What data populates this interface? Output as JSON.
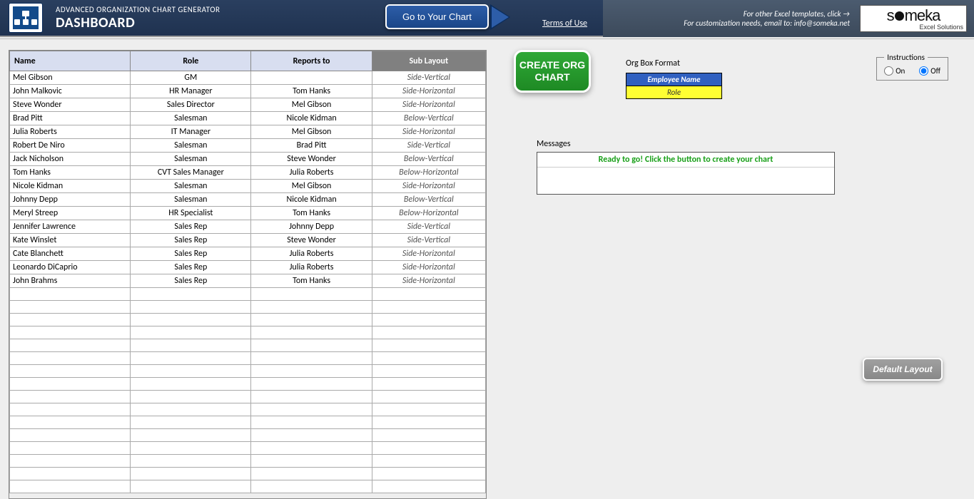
{
  "header": {
    "title_small": "ADVANCED ORGANIZATION CHART GENERATOR",
    "title_large": "DASHBOARD",
    "go_chart": "Go to Your Chart",
    "terms": "Terms of Use",
    "right_line1": "For other Excel templates, click →",
    "right_line2": "For customization needs, email to: info@someka.net",
    "logo_main": "someka",
    "logo_sub": "Excel Solutions"
  },
  "table": {
    "headers": {
      "name": "Name",
      "role": "Role",
      "reports": "Reports to",
      "sub": "Sub Layout"
    },
    "rows": [
      {
        "name": "Mel Gibson",
        "role": "GM",
        "reports": "",
        "sub": "Side-Vertical"
      },
      {
        "name": "John Malkovic",
        "role": "HR Manager",
        "reports": "Tom Hanks",
        "sub": "Side-Horizontal"
      },
      {
        "name": "Steve Wonder",
        "role": "Sales Director",
        "reports": "Mel Gibson",
        "sub": "Side-Horizontal"
      },
      {
        "name": "Brad Pitt",
        "role": "Salesman",
        "reports": "Nicole Kidman",
        "sub": "Below-Vertical"
      },
      {
        "name": "Julia Roberts",
        "role": "IT Manager",
        "reports": "Mel Gibson",
        "sub": "Side-Horizontal"
      },
      {
        "name": "Robert De Niro",
        "role": "Salesman",
        "reports": "Brad Pitt",
        "sub": "Side-Vertical"
      },
      {
        "name": "Jack Nicholson",
        "role": "Salesman",
        "reports": "Steve Wonder",
        "sub": "Below-Vertical"
      },
      {
        "name": "Tom Hanks",
        "role": "CVT Sales Manager",
        "reports": "Julia Roberts",
        "sub": "Below-Horizontal"
      },
      {
        "name": "Nicole Kidman",
        "role": "Salesman",
        "reports": "Mel Gibson",
        "sub": "Side-Horizontal"
      },
      {
        "name": "Johnny Depp",
        "role": "Salesman",
        "reports": "Nicole Kidman",
        "sub": "Below-Vertical"
      },
      {
        "name": "Meryl Streep",
        "role": "HR Specialist",
        "reports": "Tom Hanks",
        "sub": "Below-Horizontal"
      },
      {
        "name": "Jennifer Lawrence",
        "role": "Sales Rep",
        "reports": "Johnny Depp",
        "sub": "Side-Vertical"
      },
      {
        "name": "Kate Winslet",
        "role": "Sales Rep",
        "reports": "Steve Wonder",
        "sub": "Side-Vertical"
      },
      {
        "name": "Cate Blanchett",
        "role": "Sales Rep",
        "reports": "Julia Roberts",
        "sub": "Side-Horizontal"
      },
      {
        "name": "Leonardo DiCaprio",
        "role": "Sales Rep",
        "reports": "Julia Roberts",
        "sub": "Side-Horizontal"
      },
      {
        "name": "John Brahms",
        "role": "Sales Rep",
        "reports": "Tom Hanks",
        "sub": "Side-Horizontal"
      }
    ],
    "empty_rows": 16
  },
  "controls": {
    "create_line1": "CREATE ORG",
    "create_line2": "CHART",
    "format_title": "Org Box Format",
    "format_row1": "Employee Name",
    "format_row2": "Role",
    "messages_title": "Messages",
    "messages_ready": "Ready to go! Click the button to create your chart",
    "default_layout": "Default Layout",
    "instructions_title": "Instructions",
    "instructions_on": "On",
    "instructions_off": "Off"
  }
}
